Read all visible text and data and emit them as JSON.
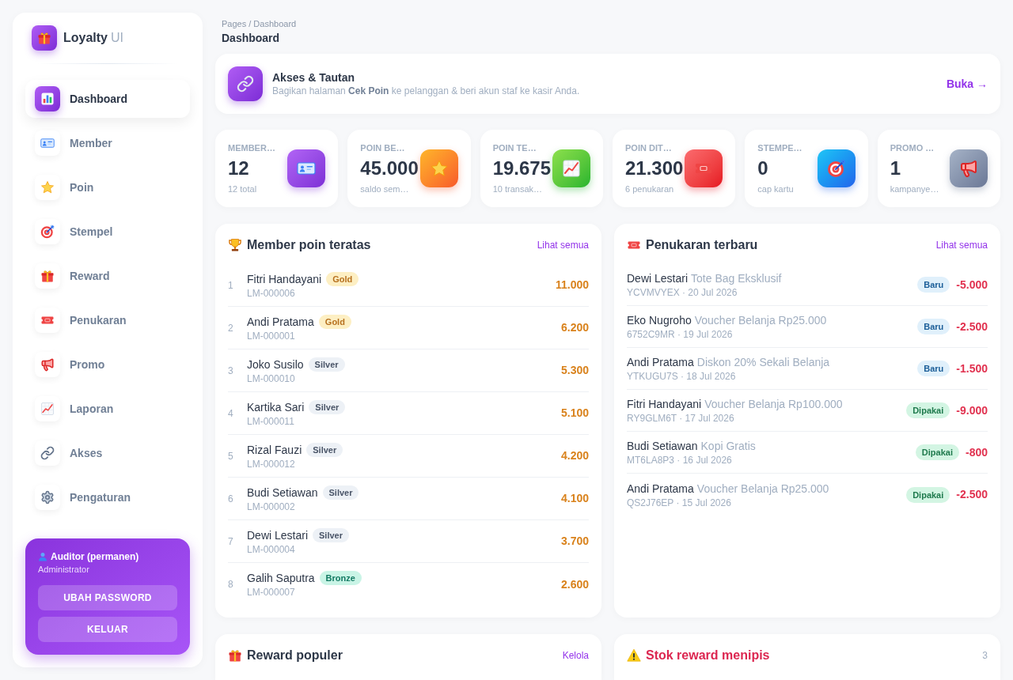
{
  "brand": {
    "name": "Loyalty",
    "suffix": "UI"
  },
  "sidebar": {
    "items": [
      {
        "label": "Dashboard",
        "selected": true
      },
      {
        "label": "Member",
        "selected": false
      },
      {
        "label": "Poin",
        "selected": false
      },
      {
        "label": "Stempel",
        "selected": false
      },
      {
        "label": "Reward",
        "selected": false
      },
      {
        "label": "Penukaran",
        "selected": false
      },
      {
        "label": "Promo",
        "selected": false
      },
      {
        "label": "Laporan",
        "selected": false
      },
      {
        "label": "Akses",
        "selected": false
      },
      {
        "label": "Pengaturan",
        "selected": false
      }
    ]
  },
  "user_card": {
    "name": "Auditor (permanen)",
    "role": "Administrator",
    "buttons": [
      "UBAH PASSWORD",
      "KELUAR"
    ]
  },
  "breadcrumb": "Pages / Dashboard",
  "page_title": "Dashboard",
  "access_banner": {
    "title": "Akses & Tautan",
    "text": "Bagikan halaman **Cek Poin** ke pelanggan & beri akun staf ke kasir Anda.",
    "link": "Buka →"
  },
  "stats": [
    {
      "label": "MEMBER…",
      "value": "12",
      "sub": "12 total"
    },
    {
      "label": "POIN BE…",
      "value": "45.000",
      "sub": "saldo sem…"
    },
    {
      "label": "POIN TE…",
      "value": "19.675",
      "sub": "10 transak…"
    },
    {
      "label": "POIN DIT…",
      "value": "21.300",
      "sub": "6 penukaran"
    },
    {
      "label": "STEMPE…",
      "value": "0",
      "sub": "cap kartu"
    },
    {
      "label": "PROMO …",
      "value": "1",
      "sub": "kampanye…"
    }
  ],
  "top_members": {
    "title": "Member poin teratas",
    "link": "Lihat semua",
    "rows": [
      {
        "rank": "1",
        "name": "Fitri Handayani",
        "tier": {
          "label": "Gold",
          "kind": "gold"
        },
        "code": "LM-000006",
        "points": "11.000"
      },
      {
        "rank": "2",
        "name": "Andi Pratama",
        "tier": {
          "label": "Gold",
          "kind": "gold"
        },
        "code": "LM-000001",
        "points": "6.200"
      },
      {
        "rank": "3",
        "name": "Joko Susilo",
        "tier": {
          "label": "Silver",
          "kind": "silver"
        },
        "code": "LM-000010",
        "points": "5.300"
      },
      {
        "rank": "4",
        "name": "Kartika Sari",
        "tier": {
          "label": "Silver",
          "kind": "silver"
        },
        "code": "LM-000011",
        "points": "5.100"
      },
      {
        "rank": "5",
        "name": "Rizal Fauzi",
        "tier": {
          "label": "Silver",
          "kind": "silver"
        },
        "code": "LM-000012",
        "points": "4.200"
      },
      {
        "rank": "6",
        "name": "Budi Setiawan",
        "tier": {
          "label": "Silver",
          "kind": "silver"
        },
        "code": "LM-000002",
        "points": "4.100"
      },
      {
        "rank": "7",
        "name": "Dewi Lestari",
        "tier": {
          "label": "Silver",
          "kind": "silver"
        },
        "code": "LM-000004",
        "points": "3.700"
      },
      {
        "rank": "8",
        "name": "Galih Saputra",
        "tier": {
          "label": "Bronze",
          "kind": "bronze"
        },
        "code": "LM-000007",
        "points": "2.600"
      }
    ]
  },
  "recent_redemptions": {
    "title": "Penukaran terbaru",
    "link": "Lihat semua",
    "rows": [
      {
        "member": "Dewi Lestari",
        "reward": "Tote Bag Eksklusif",
        "meta": "YCVMVYEX · 20 Jul 2026",
        "status": {
          "label": "Baru",
          "kind": "new"
        },
        "points": "-5.000"
      },
      {
        "member": "Eko Nugroho",
        "reward": "Voucher Belanja Rp25.000",
        "meta": "6752C9MR · 19 Jul 2026",
        "status": {
          "label": "Baru",
          "kind": "new"
        },
        "points": "-2.500"
      },
      {
        "member": "Andi Pratama",
        "reward": "Diskon 20% Sekali Belanja",
        "meta": "YTKUGU7S · 18 Jul 2026",
        "status": {
          "label": "Baru",
          "kind": "new"
        },
        "points": "-1.500"
      },
      {
        "member": "Fitri Handayani",
        "reward": "Voucher Belanja Rp100.000",
        "meta": "RY9GLM6T · 17 Jul 2026",
        "status": {
          "label": "Dipakai",
          "kind": "used"
        },
        "points": "-9.000"
      },
      {
        "member": "Budi Setiawan",
        "reward": "Kopi Gratis",
        "meta": "MT6LA8P3 · 16 Jul 2026",
        "status": {
          "label": "Dipakai",
          "kind": "used"
        },
        "points": "-800"
      },
      {
        "member": "Andi Pratama",
        "reward": "Voucher Belanja Rp25.000",
        "meta": "QS2J76EP · 15 Jul 2026",
        "status": {
          "label": "Dipakai",
          "kind": "used"
        },
        "points": "-2.500"
      }
    ]
  },
  "popular_rewards": {
    "title": "Reward populer",
    "link": "Kelola"
  },
  "low_stock": {
    "title": "Stok reward menipis",
    "count": "3"
  }
}
